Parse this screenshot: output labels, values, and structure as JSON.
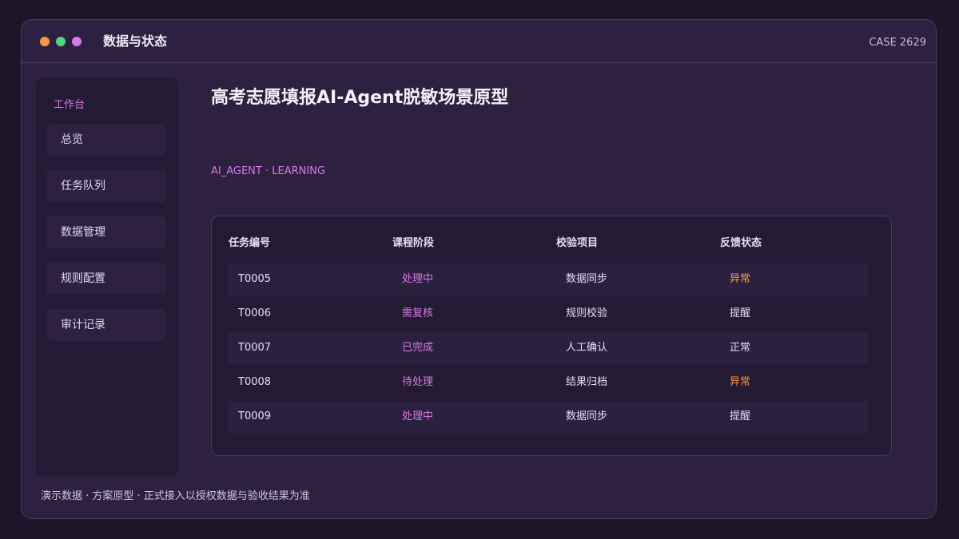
{
  "window": {
    "title": "数据与状态",
    "case_id": "CASE 2629",
    "traffic_lights": [
      "#f39a4a",
      "#4fd67e",
      "#d77ae6"
    ]
  },
  "sidebar": {
    "heading": "工作台",
    "items": [
      {
        "label": "总览",
        "active": false
      },
      {
        "label": "任务队列",
        "active": true
      },
      {
        "label": "数据管理",
        "active": false
      },
      {
        "label": "规则配置",
        "active": false
      },
      {
        "label": "审计记录",
        "active": false
      }
    ]
  },
  "main": {
    "title": "高考志愿填报AI-Agent脱敏场景原型",
    "tagline": "AI_AGENT · LEARNING"
  },
  "table": {
    "columns": [
      "任务编号",
      "课程阶段",
      "校验项目",
      "反馈状态"
    ],
    "rows": [
      {
        "id": "T0005",
        "stage": "处理中",
        "item": "数据同步",
        "status": "异常",
        "status_tone": "warn"
      },
      {
        "id": "T0006",
        "stage": "需复核",
        "item": "规则校验",
        "status": "提醒",
        "status_tone": "normal"
      },
      {
        "id": "T0007",
        "stage": "已完成",
        "item": "人工确认",
        "status": "正常",
        "status_tone": "normal"
      },
      {
        "id": "T0008",
        "stage": "待处理",
        "item": "结果归档",
        "status": "异常",
        "status_tone": "warn"
      },
      {
        "id": "T0009",
        "stage": "处理中",
        "item": "数据同步",
        "status": "提醒",
        "status_tone": "normal"
      }
    ]
  },
  "footer": {
    "note": "演示数据 · 方案原型 · 正式接入以授权数据与验收结果为准"
  },
  "colors": {
    "accent": "#d77ae6",
    "warn": "#f39a4a",
    "text": "#e6ddf0"
  }
}
